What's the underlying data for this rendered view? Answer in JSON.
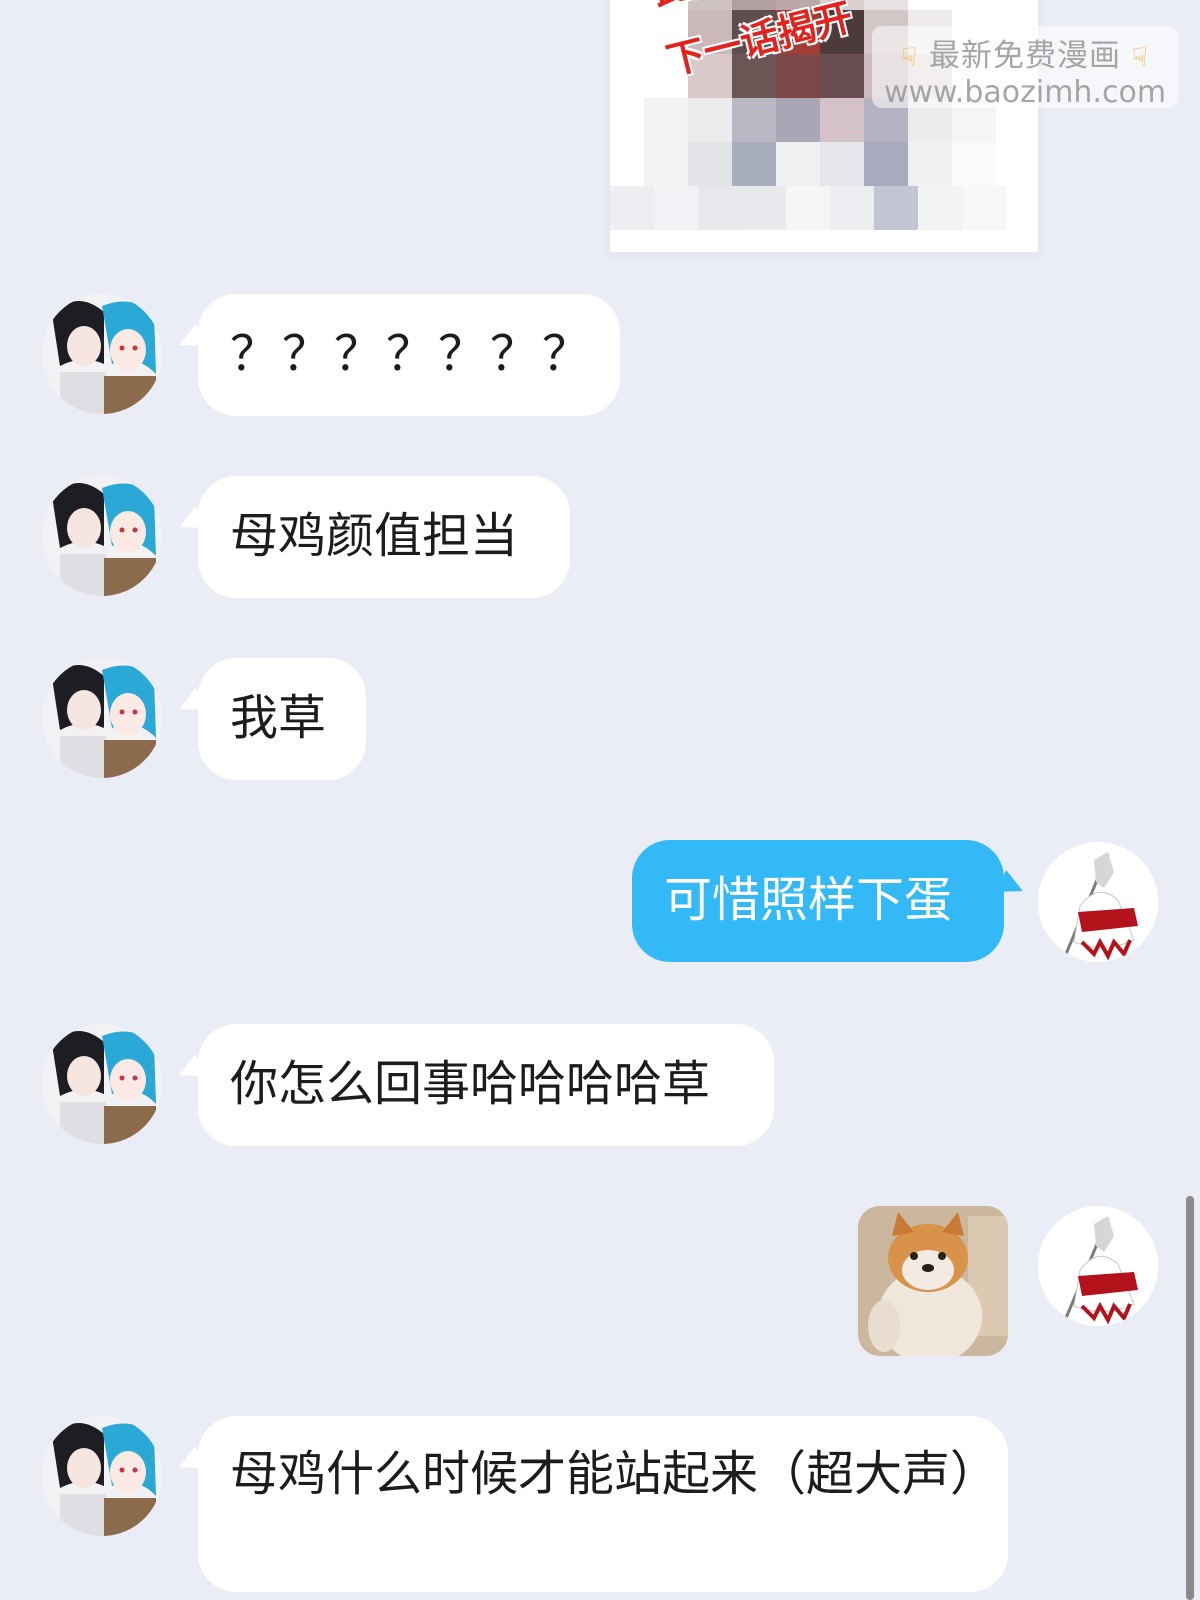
{
  "shared_image": {
    "caption_line1": "此处",
    "caption_line2": "下一话揭开",
    "watermark_line1": "最新免费漫画",
    "watermark_line2": "www.baozimh.com",
    "watermark_icon": "pointing-down-hand-icon"
  },
  "messages": [
    {
      "side": "in",
      "sender": "friend",
      "text": "？？？？？？？"
    },
    {
      "side": "in",
      "sender": "friend",
      "text": "母鸡颜值担当"
    },
    {
      "side": "in",
      "sender": "friend",
      "text": "我草"
    },
    {
      "side": "out",
      "sender": "me",
      "text": "可惜照样下蛋"
    },
    {
      "side": "in",
      "sender": "friend",
      "text": "你怎么回事哈哈哈哈草"
    },
    {
      "side": "out",
      "sender": "me",
      "type": "sticker",
      "sticker": "shiba-dog-sticker"
    },
    {
      "side": "in",
      "sender": "friend",
      "text": "母鸡什么时候才能站起来（超大声）"
    }
  ],
  "colors": {
    "background": "#eaedf6",
    "incoming_bubble": "#ffffff",
    "outgoing_bubble": "#33baf6",
    "caption_red": "#e3221d"
  }
}
